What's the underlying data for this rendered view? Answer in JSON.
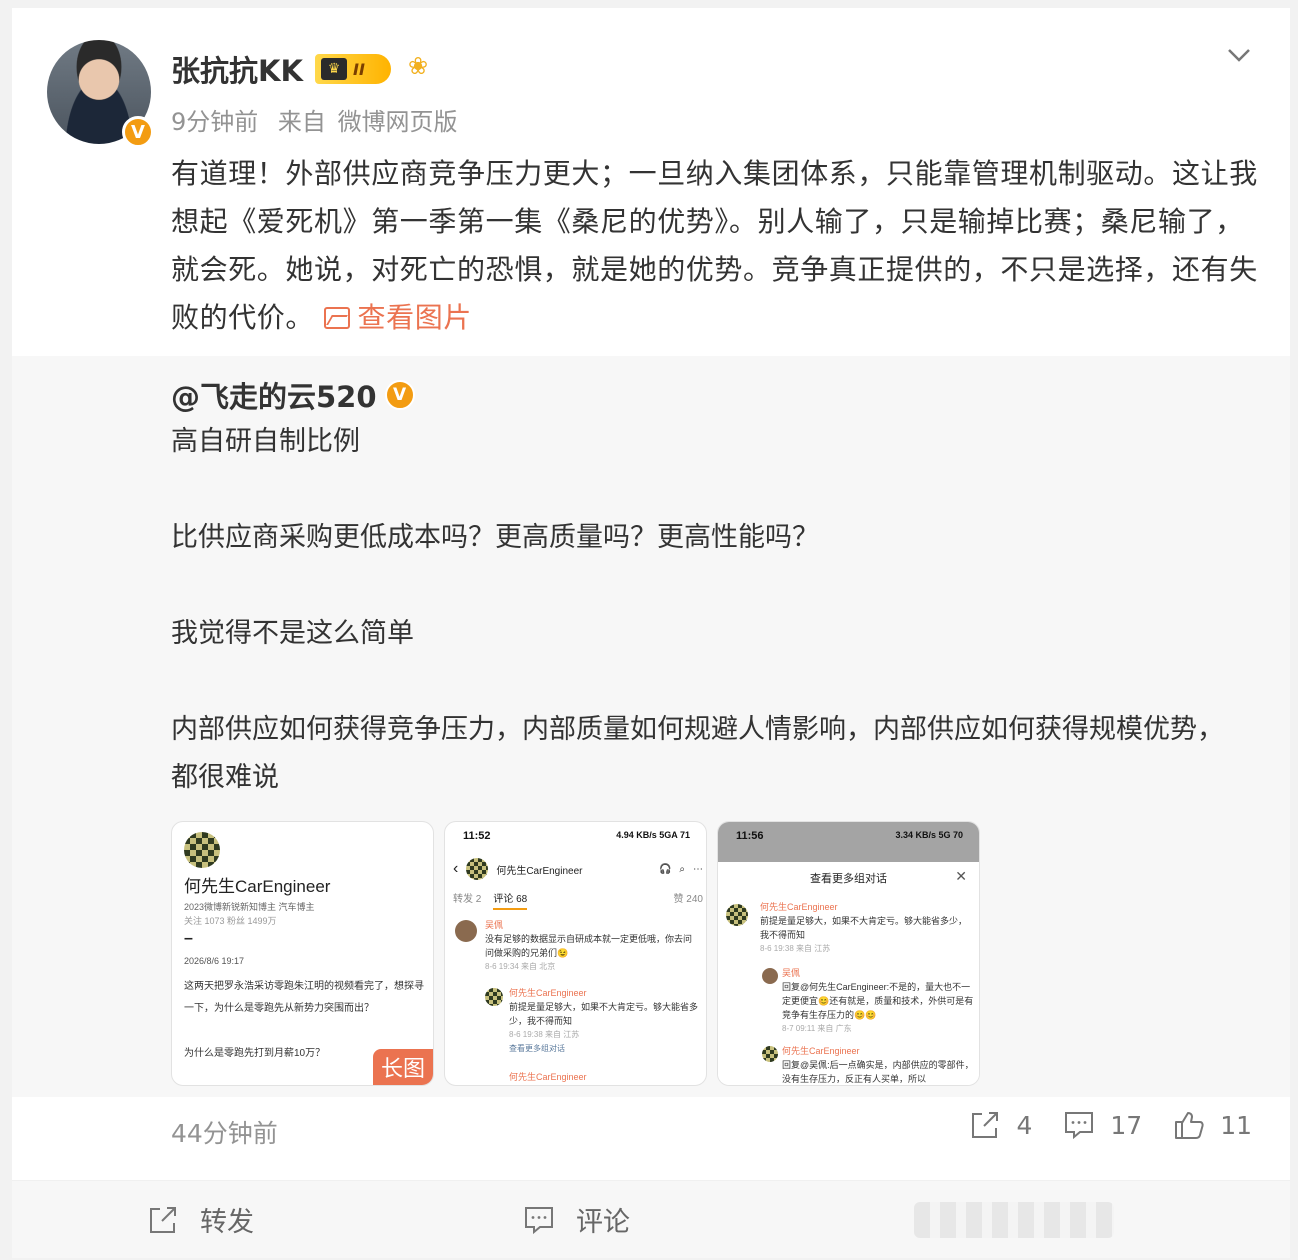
{
  "post": {
    "author": "张抗抗KK",
    "level_badge": "II",
    "time": "9分钟前",
    "source_prefix": "来自",
    "source": "微博网页版",
    "text": "有道理！外部供应商竞争压力更大；一旦纳入集团体系，只能靠管理机制驱动。这让我想起《爱死机》第一季第一集《桑尼的优势》。别人输了，只是输掉比赛；桑尼输了，就会死。她说，对死亡的恐惧，就是她的优势。竞争真正提供的，不只是选择，还有失败的代价。",
    "view_image_label": "查看图片"
  },
  "retweet": {
    "author": "@飞走的云520",
    "text": "高自研自制比例\n\n比供应商采购更低成本吗？更高质量吗？更高性能吗？\n\n我觉得不是这么简单\n\n内部供应如何获得竞争压力，内部质量如何规避人情影响，内部供应如何获得规模优势，都很难说",
    "thumb1": {
      "name": "何先生CarEngineer",
      "subtitle": "2023微博新锐新知博主 汽车博主",
      "stats": "关注 1073   粉丝 1499万",
      "dash": "–",
      "date": "2026/8/6 19:17",
      "body": "这两天把罗永浩采访零跑朱江明的视频看完了，想探寻一下，为什么是零跑先从新势力突围而出？",
      "question": "为什么是零跑先打到月薪10万？",
      "long_tag": "长图"
    },
    "thumb2": {
      "status_time": "11:52",
      "status_right": "4.94 KB/s  5GA  71",
      "nav_name": "何先生CarEngineer",
      "tab_repost": "转发 2",
      "tab_comment": "评论 68",
      "tab_like": "赞 240",
      "c1_name": "吴佩",
      "c1_text": "没有足够的数据显示自研成本就一定更低哦，你去问问做采购的兄弟们😉",
      "c1_meta": "8-6 19:34 来自 北京",
      "c2_name": "何先生CarEngineer",
      "c2_text": "前提是量足够大，如果不大肯定亏。够大能省多少，我不得而知",
      "c2_meta": "8-6 19:38 来自 江苏",
      "more": "查看更多组对话",
      "c3_name": "何先生CarEngineer"
    },
    "thumb3": {
      "status_time": "11:56",
      "status_right": "3.34 KB/s  5G  70",
      "sheet_title": "查看更多组对话",
      "c1_name": "何先生CarEngineer",
      "c1_text": "前提是量足够大，如果不大肯定亏。够大能省多少，我不得而知",
      "c1_meta": "8-6 19:38 来自 江苏",
      "c2_name": "吴佩",
      "c2_text": "回复@何先生CarEngineer:不是的，量大也不一定更便宜😊还有就是，质量和技术，外供可是有竞争有生存压力的😊😊",
      "c2_meta": "8-7 09:11 来自 广东",
      "c3_name": "何先生CarEngineer",
      "c3_text": "回复@吴佩:后一点确实是，内部供应的零部件，没有生存压力，反正有人买单，所以"
    },
    "time": "44分钟前",
    "reposts": "4",
    "comments": "17",
    "likes": "11"
  },
  "actions": {
    "repost": "转发",
    "comment": "评论"
  },
  "colors": {
    "accent": "#eb7350",
    "verified": "#f39c12",
    "muted": "#939393"
  }
}
